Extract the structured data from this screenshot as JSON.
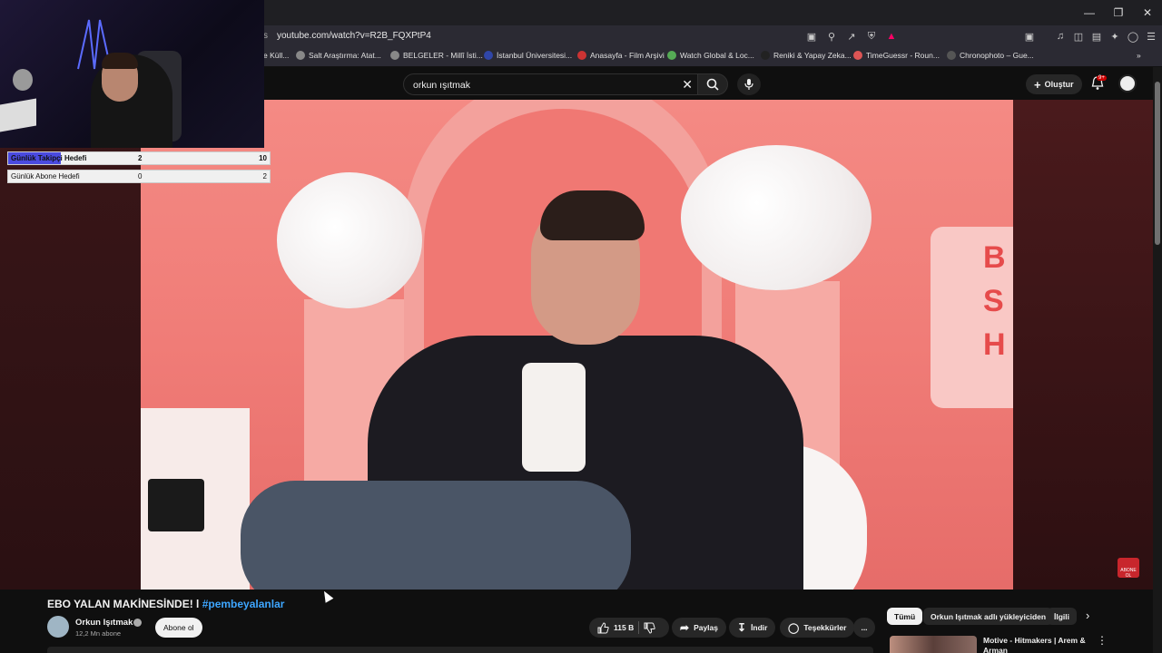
{
  "browser": {
    "url": "youtube.com/watch?v=R2B_FQXPtP4",
    "url_prefix": "s",
    "bookmarks": [
      {
        "label": "e Küll..."
      },
      {
        "label": "Salt Araştırma: Atat..."
      },
      {
        "label": "BELGELER - Millî İsti..."
      },
      {
        "label": "İstanbul Üniversitesi..."
      },
      {
        "label": "Anasayfa - Film Arşivi"
      },
      {
        "label": "Watch Global & Loc..."
      },
      {
        "label": "Reniki & Yapay Zeka..."
      },
      {
        "label": "TimeGuessr - Roun..."
      },
      {
        "label": "Chronophoto – Gue..."
      }
    ],
    "bookmarks_overflow": "»"
  },
  "youtube": {
    "search_query": "orkun ışıtmak",
    "create_label": "Oluştur",
    "notification_count": "9+"
  },
  "overlay": {
    "goals": [
      {
        "label": "Günlük Takipçi Hedefi",
        "current": "2",
        "target": "10",
        "progress": 0.2
      },
      {
        "label": "Günlük Abone Hedefi",
        "current": "0",
        "target": "2",
        "progress": 0
      }
    ]
  },
  "player": {
    "sign_text": "B\nS\nH",
    "corner_logo": "ABONE OL"
  },
  "video": {
    "title": "EBO YALAN MAKİNESİNDE! l ",
    "hashtag": "#pembeyalanlar",
    "channel_name": "Orkun Işıtmak",
    "subscribers": "12,2 Mn abone",
    "subscribe_label": "Abone ol",
    "likes": "115 B",
    "share_label": "Paylaş",
    "download_label": "İndir",
    "thanks_label": "Teşekkürler",
    "more_label": "..."
  },
  "recommendations": {
    "chips": [
      "Tümü",
      "Orkun Işıtmak adlı yükleyiciden",
      "İlgili"
    ],
    "first_title": "Motive - Hitmakers | Arem & Arman"
  }
}
